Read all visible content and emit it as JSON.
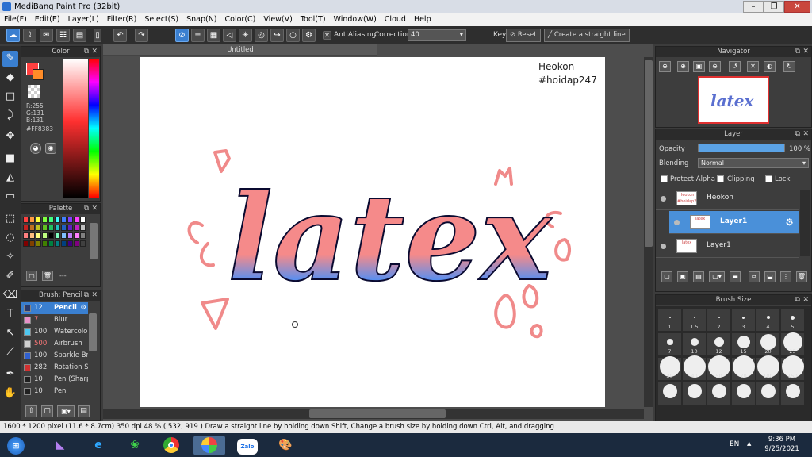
{
  "window": {
    "title": "MediBang Paint Pro (32bit)"
  },
  "menu": [
    "File(F)",
    "Edit(E)",
    "Layer(L)",
    "Filter(R)",
    "Select(S)",
    "Snap(N)",
    "Color(C)",
    "View(V)",
    "Tool(T)",
    "Window(W)",
    "Cloud",
    "Help"
  ],
  "toolbar": {
    "antialiasing_label": "AntiAliasing",
    "correction_label": "Correction",
    "correction_value": "40",
    "key_label": "Key",
    "reset_label": "Reset",
    "straight_line_label": "Create a straight line"
  },
  "color_panel": {
    "title": "Color",
    "r": "R:255",
    "g": "G:131",
    "b": "B:131",
    "hex": "#FF8383",
    "primary_color": "#ff8383"
  },
  "palette_panel": {
    "title": "Palette",
    "dash": "---",
    "swatches": [
      "#ff4040",
      "#ff9a40",
      "#ffff40",
      "#80ff40",
      "#40ff80",
      "#40ffff",
      "#4080ff",
      "#8040ff",
      "#ff40ff",
      "#ffffff",
      "#c02020",
      "#c07020",
      "#c0c020",
      "#60c020",
      "#20c060",
      "#20c0c0",
      "#2060c0",
      "#6020c0",
      "#c020c0",
      "#c0c0c0",
      "#ff8080",
      "#ffc080",
      "#ffff80",
      "#c0ff80",
      "#000000",
      "#80ffc0",
      "#80c0ff",
      "#c080ff",
      "#ff80ff",
      "#808080",
      "#800000",
      "#804000",
      "#808000",
      "#408000",
      "#008040",
      "#008080",
      "#004080",
      "#400080",
      "#800080",
      "#404040"
    ]
  },
  "brush_panel": {
    "title": "Brush: Pencil",
    "items": [
      {
        "num": "12",
        "name": "Pencil",
        "color": "#2a3b6e"
      },
      {
        "num": "7",
        "name": "Blur",
        "color": "#e890c8"
      },
      {
        "num": "100",
        "name": "Watercolor",
        "color": "#4ec7f0"
      },
      {
        "num": "500",
        "name": "Airbrush",
        "color": "#d0d0d0"
      },
      {
        "num": "100",
        "name": "Sparkle Br",
        "color": "#3060d0"
      },
      {
        "num": "282",
        "name": "Rotation S",
        "color": "#d03030"
      },
      {
        "num": "10",
        "name": "Pen (Sharp",
        "color": "#202020"
      },
      {
        "num": "10",
        "name": "Pen",
        "color": "#202020"
      }
    ]
  },
  "canvas": {
    "tab_title": "Untitled",
    "watermark_line1": "Heokon",
    "watermark_line2": "#hoidap247",
    "lettering": "latex"
  },
  "navigator": {
    "title": "Navigator"
  },
  "layer_panel": {
    "title": "Layer",
    "opacity_label": "Opacity",
    "opacity_value": "100 %",
    "opacity_fraction": 1.0,
    "blending_label": "Blending",
    "blending_value": "Normal",
    "protect_alpha_label": "Protect Alpha",
    "clipping_label": "Clipping",
    "lock_label": "Lock",
    "layers": [
      {
        "name": "Heokon",
        "selected": false,
        "thumb": "Heokon #hoidap247"
      },
      {
        "name": "Layer1",
        "selected": true,
        "thumb": "latex"
      },
      {
        "name": "Layer1",
        "selected": false,
        "thumb": "latex"
      }
    ]
  },
  "brush_size_panel": {
    "title": "Brush Size",
    "sizes": [
      "1",
      "1.5",
      "2",
      "3",
      "4",
      "5",
      "7",
      "10",
      "12",
      "15",
      "20",
      "25",
      "30",
      "40",
      "50",
      "70",
      "100",
      "150"
    ]
  },
  "status": {
    "text": "1600 * 1200 pixel   (11.6 * 8.7cm)   350 dpi   48 %   ( 532, 919 )   Draw a straight line by holding down Shift, Change a brush size by holding down Ctrl, Alt, and dragging"
  },
  "taskbar": {
    "language": "EN",
    "time": "9:36 PM",
    "date": "9/25/2021",
    "zalo_label": "Zalo"
  }
}
